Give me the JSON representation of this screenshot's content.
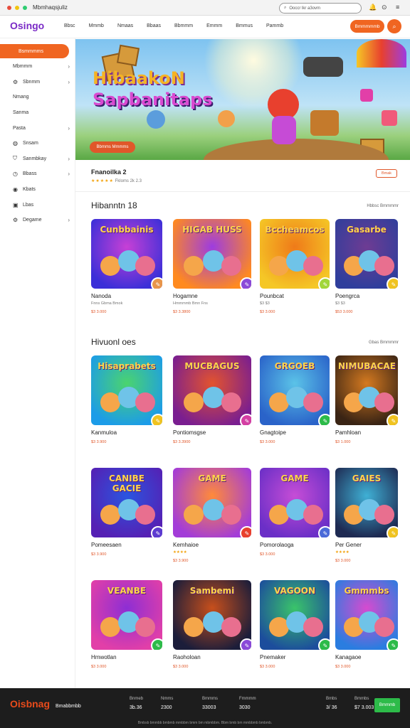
{
  "browser": {
    "title": "Mbmhaqsjuliz",
    "search_placeholder": "Ooccr lkr a3ovm"
  },
  "nav": {
    "logo": "Osingo",
    "links": [
      "Bbsc",
      "Mmmb",
      "Nmaas",
      "Bbaas",
      "Bbmmm",
      "Emmm",
      "Bmmus",
      "Pammb"
    ],
    "cta": "Bmmmmmb"
  },
  "sidebar": {
    "items": [
      {
        "label": "Bsmmmms",
        "active": true,
        "icon": "",
        "chevron": false
      },
      {
        "label": "Mbmmm",
        "icon": "",
        "chevron": true
      },
      {
        "label": "Sbnmm",
        "icon": "settings-icon",
        "chevron": true
      },
      {
        "label": "Nmang",
        "icon": "",
        "chevron": false
      },
      {
        "label": "Sanma",
        "icon": "",
        "chevron": false
      },
      {
        "label": "Pasta",
        "icon": "",
        "chevron": true
      },
      {
        "label": "Snsam",
        "icon": "globe-icon",
        "chevron": false
      },
      {
        "label": "Sanmbkay",
        "icon": "shield-icon",
        "chevron": true
      },
      {
        "label": "Bbass",
        "icon": "clock-icon",
        "chevron": true
      },
      {
        "label": "Kbats",
        "icon": "pin-icon",
        "chevron": false
      },
      {
        "label": "Lbas",
        "icon": "image-icon",
        "chevron": false
      },
      {
        "label": "Degame",
        "icon": "gear-icon",
        "chevron": true
      }
    ]
  },
  "hero": {
    "title_line1": "HibaakoN",
    "title_line2": "Sapbanitaps",
    "cta": "Bbmms Mmmms"
  },
  "featured": {
    "title": "Fnanoilka 2",
    "stars": "★★★★★",
    "meta": "Fkloms 2k 2.3",
    "pill": "Bmak"
  },
  "section1": {
    "title": "Hibanntn 18",
    "link": "Hbbsc Bmmmmr",
    "cards": [
      {
        "thumb_title": "Cunbbainis",
        "name": "Nanoda",
        "sub": "Fnns Gbma Bmok",
        "price": "$3 3.000",
        "color1": "#3b2fd8",
        "color2": "#c740d6",
        "badge": "#e8954a"
      },
      {
        "thumb_title": "HIGAB HUSS",
        "name": "Hogamne",
        "sub": "Hmmmmb Bmn Fns",
        "price": "$3 3.3800",
        "color1": "#ff8a1f",
        "color2": "#9d3ce0",
        "badge": "#8a4ad8"
      },
      {
        "thumb_title": "Bccheamcos",
        "name": "Pounbcat",
        "sub": "$3 $3",
        "price": "$3 3.000",
        "color1": "#f5c726",
        "color2": "#ef7a19",
        "badge": "#a1d63a"
      },
      {
        "thumb_title": "Gasarbe",
        "name": "Poengrca",
        "sub": "$3 $3",
        "price": "$53 3.000",
        "color1": "#2f3e9c",
        "color2": "#6e3c93",
        "badge": "#f0c320"
      }
    ]
  },
  "section2": {
    "title": "Hivuonl oes",
    "link": "Gbas Bmmmmr",
    "cards": [
      {
        "thumb_title": "Hisaprabets",
        "name": "Kanmuloa",
        "sub": "",
        "price": "$3 3.900",
        "color1": "#1c9ce8",
        "color2": "#4bd46e",
        "badge": "#f0c320"
      },
      {
        "thumb_title": "MUCBAGUS",
        "name": "Pontiomsgse",
        "sub": "",
        "price": "$3 3.3900",
        "color1": "#7a1e90",
        "color2": "#e3532e",
        "badge": "#d43fa3"
      },
      {
        "thumb_title": "GRGOEB",
        "name": "Gnagtoipe",
        "sub": "",
        "price": "$3 3.000",
        "color1": "#2a63c9",
        "color2": "#5bc3e8",
        "badge": "#2dbb49"
      },
      {
        "thumb_title": "NIMUBACAE",
        "name": "Pamhloan",
        "sub": "",
        "price": "$3 1.000",
        "color1": "#3a2414",
        "color2": "#d57a20",
        "badge": "#f0c320"
      },
      {
        "thumb_title": "CANIBE GACIE",
        "name": "Pomeesaen",
        "sub": "",
        "price": "$3 3.900",
        "color1": "#5520b4",
        "color2": "#2a55e0",
        "badge": "#5c3bd0"
      },
      {
        "thumb_title": "GAME",
        "name": "Kemhaioe",
        "sub": "★★★★",
        "price": "$3 3.900",
        "color1": "#a33cd8",
        "color2": "#ff8a3a",
        "badge": "#e8402e"
      },
      {
        "thumb_title": "GAME",
        "name": "Pomorolaoga",
        "sub": "",
        "price": "$3 3.000",
        "color1": "#6b2fc7",
        "color2": "#c64dd6",
        "badge": "#4a6ad8"
      },
      {
        "thumb_title": "GAIES",
        "name": "Per Gener",
        "sub": "★★★★",
        "price": "$3 3.000",
        "color1": "#1e2a52",
        "color2": "#3fb0d5",
        "badge": "#f0c320"
      },
      {
        "thumb_title": "VEANBE",
        "name": "Hmwotlan",
        "sub": "",
        "price": "$3 3.000",
        "color1": "#e23fa8",
        "color2": "#8d2ed4",
        "badge": "#2dbb49"
      },
      {
        "thumb_title": "Sambemi",
        "name": "Raoholoan",
        "sub": "",
        "price": "$3 3.000",
        "color1": "#1b1d3a",
        "color2": "#c74f1c",
        "badge": "#8a4ad8"
      },
      {
        "thumb_title": "VAGOON",
        "name": "Pnemaker",
        "sub": "",
        "price": "$3 3.000",
        "color1": "#1c4d9c",
        "color2": "#3ac46a",
        "badge": "#2dbb49"
      },
      {
        "thumb_title": "Gmmmbs",
        "name": "Kanagaoe",
        "sub": "",
        "price": "$3 3.000",
        "color1": "#2a7de0",
        "color2": "#d64bd0",
        "badge": "#2dbb49"
      }
    ]
  },
  "footer": {
    "logo": "Oisbnag",
    "brand": "Bmabbmbb",
    "cols": [
      {
        "h": "Bnmeb",
        "v": "3b.36"
      },
      {
        "h": "Nmms",
        "v": "2300"
      },
      {
        "h": "Bmmms",
        "v": "33003"
      },
      {
        "h": "Fmmmm",
        "v": "3030"
      },
      {
        "h": "Bmbs",
        "v": "3/ 36"
      },
      {
        "h": "Bmmbs",
        "v": "$7 3.003"
      }
    ],
    "button": "Bmmmb",
    "copyright": "Bmbsb bmmbb bmbmb mmbbm bmm bm mbmbbm. Bbm bmb bm mmbbmb bmbmb."
  }
}
